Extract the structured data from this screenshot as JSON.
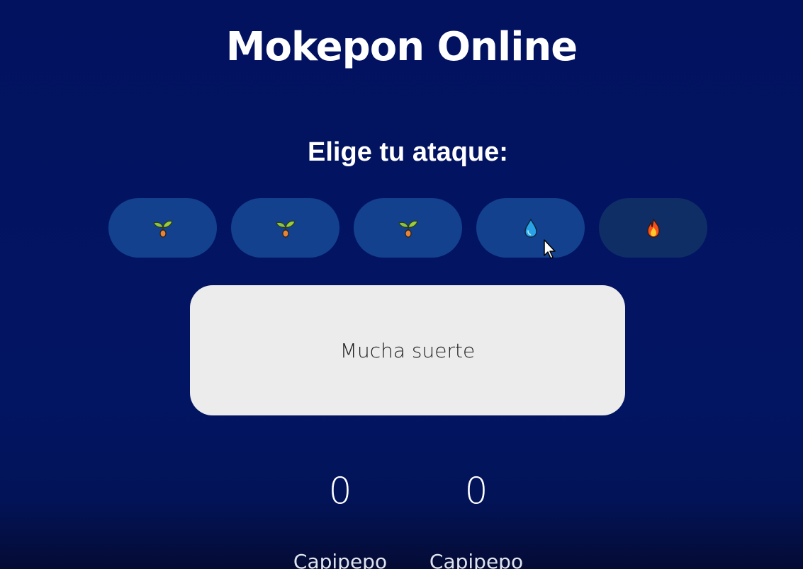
{
  "app": {
    "title": "Mokepon Online"
  },
  "attack_section": {
    "heading": "Elige tu ataque:",
    "buttons": [
      {
        "icon": "seedling-icon",
        "state": "enabled"
      },
      {
        "icon": "seedling-icon",
        "state": "enabled"
      },
      {
        "icon": "seedling-icon",
        "state": "enabled"
      },
      {
        "icon": "water-drop-icon",
        "state": "enabled"
      },
      {
        "icon": "fire-icon",
        "state": "disabled"
      }
    ]
  },
  "message": {
    "text": "Mucha suerte"
  },
  "scoreboard": {
    "player_wins": "0",
    "enemy_wins": "0",
    "player_pet": "Capipepo",
    "enemy_pet": "Capipepo"
  },
  "colors": {
    "background": "#02125f",
    "button": "#13418d",
    "button_disabled": "#0f2e66",
    "message_box": "#ececec"
  }
}
